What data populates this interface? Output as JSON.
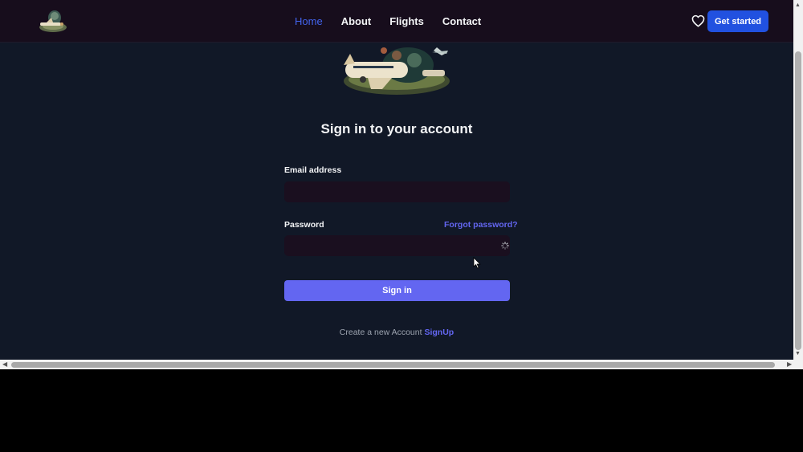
{
  "nav": {
    "links": [
      "Home",
      "About",
      "Flights",
      "Contact"
    ],
    "active": "Home",
    "cta_label": "Get started",
    "heart_icon": "heart-icon"
  },
  "form": {
    "title": "Sign in to your account",
    "email_label": "Email address",
    "email_value": "",
    "password_label": "Password",
    "password_value": "",
    "forgot_label": "Forgot password?",
    "submit_label": "Sign in",
    "signup_prompt": "Create a new Account",
    "signup_link": "SignUp"
  },
  "colors": {
    "background": "#111827",
    "navbar": "#170d1c",
    "accent": "#6366f1",
    "cta": "#2151e0",
    "active_link": "#4263eb",
    "input_bg": "#1a0f1f"
  }
}
